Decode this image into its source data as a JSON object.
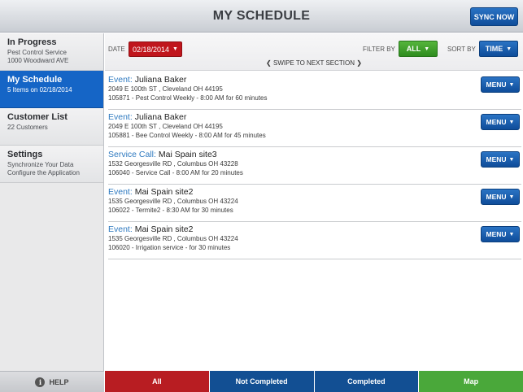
{
  "header": {
    "title": "MY SCHEDULE",
    "sync_label": "SYNC NOW"
  },
  "sidebar": {
    "items": [
      {
        "title": "In Progress",
        "lines": [
          "Pest Control Service",
          "1000 Woodward AVE"
        ],
        "active": false
      },
      {
        "title": "My Schedule",
        "lines": [
          "5 Items on 02/18/2014"
        ],
        "active": true
      },
      {
        "title": "Customer List",
        "lines": [
          "22 Customers"
        ],
        "active": false
      },
      {
        "title": "Settings",
        "lines": [
          "Synchronize Your Data",
          "Configure the Application"
        ],
        "active": false
      }
    ],
    "help_label": "HELP"
  },
  "toolbar": {
    "date_label": "DATE",
    "date_value": "02/18/2014",
    "filter_label": "FILTER BY",
    "filter_value": "ALL",
    "sort_label": "SORT BY",
    "sort_value": "TIME",
    "swipe_hint": "SWIPE TO NEXT SECTION"
  },
  "schedule": [
    {
      "type": "Event:",
      "name": "Juliana Baker",
      "address": "2049 E 100th ST , Cleveland OH 44195",
      "detail": "105871 - Pest Control Weekly - 8:00 AM for 60 minutes",
      "menu": "MENU"
    },
    {
      "type": "Event:",
      "name": "Juliana Baker",
      "address": "2049 E 100th ST , Cleveland OH 44195",
      "detail": "105881 - Bee Control Weekly - 8:00 AM for 45 minutes",
      "menu": "MENU"
    },
    {
      "type": "Service Call:",
      "name": "Mai Spain site3",
      "address": "1532 Georgesville RD , Columbus OH 43228",
      "detail": "106040 - Service Call - 8:00 AM for 20 minutes",
      "menu": "MENU"
    },
    {
      "type": "Event:",
      "name": "Mai Spain site2",
      "address": "1535 Georgesville RD , Columbus OH 43224",
      "detail": "106022 - Termite2 - 8:30 AM for 30 minutes",
      "menu": "MENU"
    },
    {
      "type": "Event:",
      "name": "Mai Spain site2",
      "address": "1535 Georgesville RD , Columbus OH 43224",
      "detail": "106020 - Irrigation service - for 30 minutes",
      "menu": "MENU"
    }
  ],
  "bottom_tabs": [
    {
      "label": "All",
      "color": "#b81d22"
    },
    {
      "label": "Not Completed",
      "color": "#124f93"
    },
    {
      "label": "Completed",
      "color": "#124f93"
    },
    {
      "label": "Map",
      "color": "#4aa83a"
    }
  ],
  "colors": {
    "accent_blue": "#1565c6",
    "date_red": "#c0161d",
    "filter_green": "#2f8c1f",
    "event_type_blue": "#2f7ac0"
  },
  "icons": {
    "caret": "chevron-down-icon",
    "swipe_left": "chevron-left-icon",
    "swipe_right": "chevron-right-icon",
    "help": "info-icon"
  }
}
